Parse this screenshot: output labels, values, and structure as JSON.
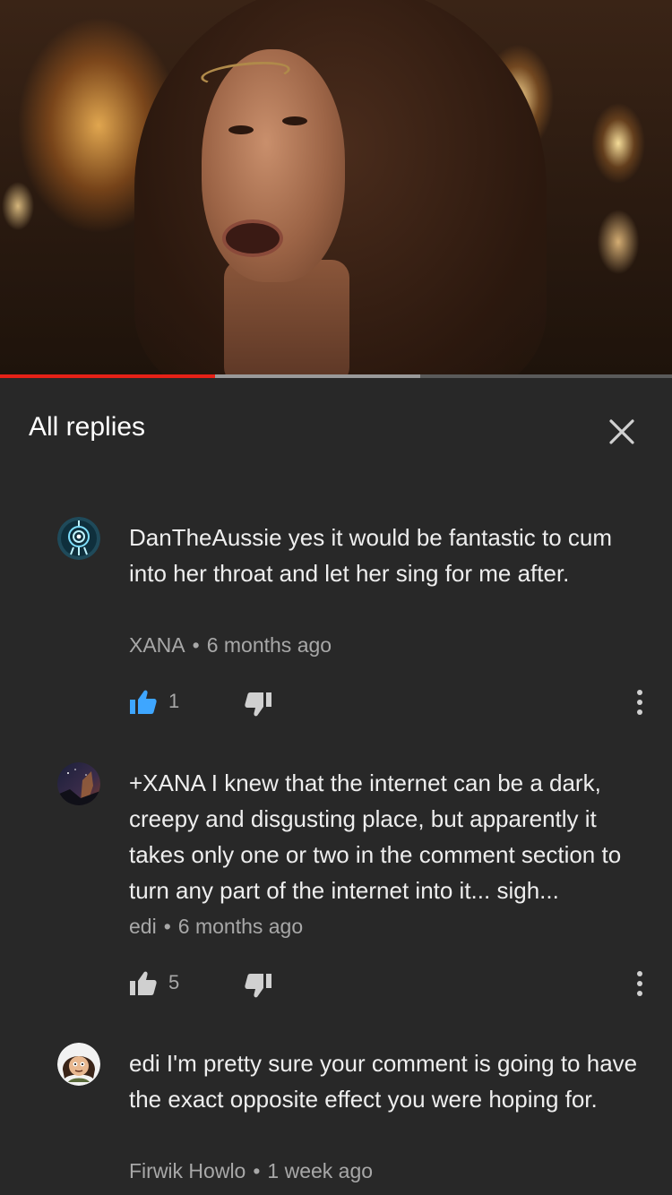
{
  "video": {
    "progress_played": 0.32,
    "progress_buffered": 0.625
  },
  "panel": {
    "title": "All replies"
  },
  "comments": [
    {
      "text": "DanTheAussie yes it would be fantastic to cum into her throat and let her sing for me after.",
      "author": "XANA",
      "time": "6 months ago",
      "likes": "1",
      "liked": true,
      "avatar_icon": "target-emblem-icon"
    },
    {
      "text": "+XANA I knew that the internet can be a dark, creepy and disgusting place, but apparently it takes only one or two in the comment section to turn any part of the internet into it... sigh...",
      "author": "edi",
      "time": "6 months ago",
      "likes": "5",
      "liked": false,
      "avatar_icon": "night-scene-avatar-icon"
    },
    {
      "text": "edi I'm pretty sure your comment is going to have the exact opposite effect you were hoping for.",
      "author": "Firwik Howlo",
      "time": "1 week ago",
      "avatar_icon": "cartoon-character-avatar-icon"
    }
  ],
  "colors": {
    "background": "#282828",
    "liked_blue": "#3ea6ff",
    "icon_gray": "#d0d0d0",
    "progress_red": "#e62117"
  }
}
